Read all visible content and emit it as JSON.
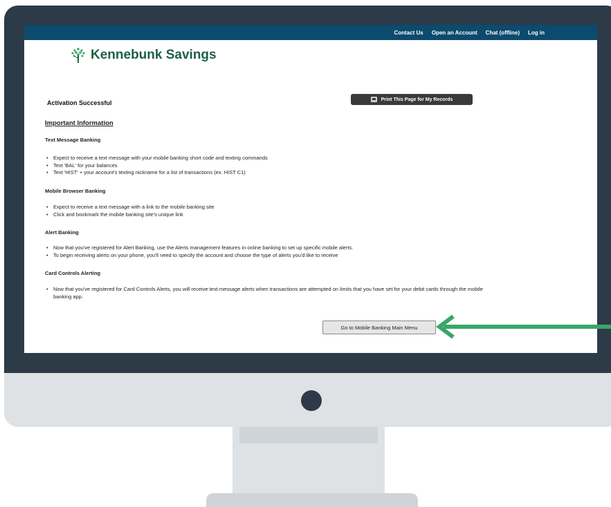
{
  "colors": {
    "bezel": "#2d3a48",
    "monitor_silver": "#dee2e5",
    "nav_bar": "#0c4a6e",
    "logo_green": "#1d5f47",
    "arrow_green": "#3aa66a"
  },
  "nav": {
    "links": [
      "Contact Us",
      "Open an Account",
      "Chat (offline)",
      "Log in"
    ]
  },
  "brand": {
    "name": "Kennebunk Savings",
    "logo_icon": "tree-icon"
  },
  "page": {
    "status_title": "Activation Successful",
    "print_button_label": "Print This Page for My Records",
    "important_heading": "Important Information",
    "sections": [
      {
        "title": "Text Message Banking",
        "items": [
          "Expect to receive a text message with your mobile banking short code and texting commands",
          "Text 'BAL' for your balances",
          "Text 'HIST' + your account's texting nickname for a list of transactions (ex. HIST C1)"
        ]
      },
      {
        "title": "Mobile Browser Banking",
        "items": [
          "Expect to receive a text message with a link to the mobile banking site",
          "Click and bookmark the mobile banking site's unique link"
        ]
      },
      {
        "title": "Alert Banking",
        "items": [
          "Now that you've registered for Alert Banking, use the Alerts management features in online banking to set up specific mobile alerts.",
          "To begin receiving alerts on your phone, you'll need to specify the account and choose the type of alerts you'd like to receive"
        ]
      },
      {
        "title": "Card Controls Alerting",
        "items": [
          "Now that you've registered for Card Controls Alerts, you will receive text message alerts when transactions are attempted on limits that you have set for your debit cards through the mobile banking app."
        ]
      }
    ],
    "main_menu_button_label": "Go to Mobile Banking Main Menu"
  }
}
